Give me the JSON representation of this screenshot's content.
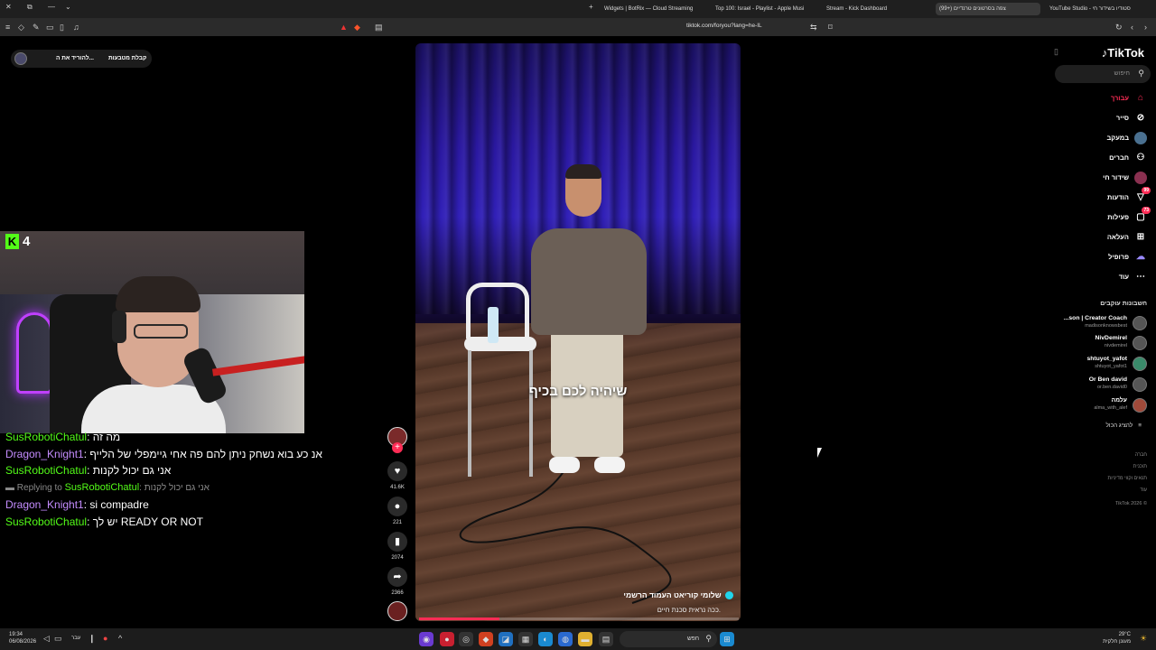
{
  "browser": {
    "tabs": [
      {
        "label": "Widgets | BotRix — Cloud Streaming"
      },
      {
        "label": "Top 100: Israel - Playlist - Apple Music"
      },
      {
        "label": "Stream - Kick Dashboard"
      },
      {
        "label": "(99+) צפה בסרטונים טרנדיים"
      },
      {
        "label": "YouTube Studio - סטודיו בשידור חי"
      }
    ],
    "url": "tiktok.com/foryou?lang=he-IL"
  },
  "overlay": {
    "btn1": "להוריד את ה...",
    "btn2": "קבלת מטבעות"
  },
  "stream": {
    "platform_letter": "K",
    "viewers": "4"
  },
  "chat": {
    "messages": [
      {
        "user": "SusRoboti​Chatul",
        "color": "green",
        "text": "מה זה"
      },
      {
        "user": "Dragon_Knight1",
        "color": "purple",
        "text": "אנ כע בוא נשחק ניתן להם פה אחי גיימפלי של הלייף"
      },
      {
        "user": "SusRoboti​Chatul",
        "color": "green",
        "text": "אני גם יכול לקנות"
      },
      {
        "user": "Dragon_Knight1",
        "color": "purple",
        "text": "si compadre"
      },
      {
        "user": "SusRoboti​Chatul",
        "color": "green",
        "text": "יש לך READY OR NOT"
      }
    ],
    "reply": {
      "prefix": "Replying to",
      "user": "SusRoboti​Chatul",
      "text": "אני גם יכול לקנות"
    }
  },
  "video": {
    "caption": "שיהיה לכם בכיף",
    "author": "שלומי קוריאט העמוד הרשמי",
    "description": "ככה נראית סכנת חיים.",
    "progress_pct": 25
  },
  "actions": {
    "likes": "41.6K",
    "comments": "221",
    "saves": "2074",
    "shares": "2366"
  },
  "tiktok": {
    "logo": "TikTok",
    "search_placeholder": "חיפוש",
    "nav": [
      {
        "label": "עבורך",
        "icon": "home-icon"
      },
      {
        "label": "סייר",
        "icon": "compass-icon"
      },
      {
        "label": "במעקב",
        "icon": "following-icon"
      },
      {
        "label": "חברים",
        "icon": "friends-icon"
      },
      {
        "label": "שידור חי",
        "icon": "live-icon"
      },
      {
        "label": "הודעות",
        "icon": "messages-icon",
        "badge": "99"
      },
      {
        "label": "פעילות",
        "icon": "activity-icon",
        "badge": "73"
      },
      {
        "label": "העלאה",
        "icon": "upload-icon"
      },
      {
        "label": "פרופיל",
        "icon": "profile-icon"
      },
      {
        "label": "עוד",
        "icon": "more-icon"
      }
    ],
    "following_title": "חשבונות עוקבים",
    "accounts": [
      {
        "name": "...son | Creator Coach",
        "handle": "madisonknowsbest"
      },
      {
        "name": "NivDemirel",
        "handle": "nivdemirel"
      },
      {
        "name": "shtuyot_yafot",
        "handle": "shtuyot_yafot1"
      },
      {
        "name": "Or Ben david",
        "handle": "or.ben.david0"
      },
      {
        "name": "עלמה",
        "handle": "alma_with_alef"
      }
    ],
    "see_all": "להציג הכול",
    "footer": [
      "חברה",
      "תוכנית",
      "תנאים וקווי מדיניות",
      "עוד",
      "TikTok 2026 ©"
    ]
  },
  "taskbar": {
    "time": "19:34",
    "date": "06/08/2026",
    "lang": "עבר",
    "search": "חפש",
    "temp": "29°C",
    "weather": "מעונן חלקית"
  }
}
